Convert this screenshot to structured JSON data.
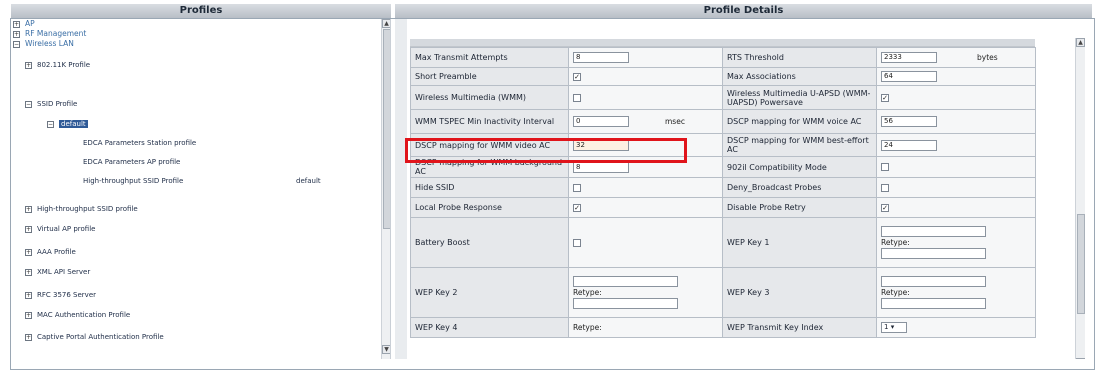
{
  "headers": {
    "profiles": "Profiles",
    "profile_details": "Profile Details"
  },
  "tree": {
    "top": [
      {
        "toggle": "+",
        "label": "AP"
      },
      {
        "toggle": "+",
        "label": "RF Management"
      },
      {
        "toggle": "−",
        "label": "Wireless LAN"
      }
    ],
    "wlan": {
      "k_profile": {
        "toggle": "+",
        "label": "802.11K Profile"
      },
      "ssid_profile": {
        "toggle": "−",
        "label": "SSID Profile"
      },
      "default": {
        "toggle": "−",
        "label": "default"
      },
      "children": [
        {
          "label": "EDCA Parameters Station profile",
          "value": ""
        },
        {
          "label": "EDCA Parameters AP profile",
          "value": ""
        },
        {
          "label": "High-throughput SSID Profile",
          "value": "default"
        }
      ],
      "more": [
        {
          "toggle": "+",
          "label": "High-throughput SSID profile"
        },
        {
          "toggle": "+",
          "label": "Virtual AP profile"
        },
        {
          "toggle": "+",
          "label": "AAA Profile"
        },
        {
          "toggle": "+",
          "label": "XML API Server"
        },
        {
          "toggle": "+",
          "label": "RFC 3576 Server"
        },
        {
          "toggle": "+",
          "label": "MAC Authentication Profile"
        },
        {
          "toggle": "+",
          "label": "Captive Portal Authentication Profile"
        }
      ]
    }
  },
  "details": {
    "max_transmit_attempts": {
      "label": "Max Transmit Attempts",
      "value": "8"
    },
    "rts_threshold": {
      "label": "RTS Threshold",
      "value": "2333",
      "unit": "bytes"
    },
    "short_preamble": {
      "label": "Short Preamble",
      "checked": "✓"
    },
    "max_associations": {
      "label": "Max Associations",
      "value": "64"
    },
    "wmm": {
      "label": "Wireless Multimedia (WMM)",
      "checked": ""
    },
    "wmm_uapsd": {
      "label": "Wireless Multimedia U-APSD (WMM-UAPSD) Powersave",
      "checked": "✓"
    },
    "wmm_tspec": {
      "label": "WMM TSPEC Min Inactivity Interval",
      "value": "0",
      "unit": "msec"
    },
    "dscp_voice": {
      "label": "DSCP mapping for WMM voice AC",
      "value": "56"
    },
    "dscp_video": {
      "label": "DSCP mapping for WMM video AC",
      "value": "32"
    },
    "dscp_best_effort": {
      "label": "DSCP mapping for WMM best-effort AC",
      "value": "24"
    },
    "dscp_background": {
      "label": "DSCP mapping for WMM background AC",
      "value": "8"
    },
    "compat_902il": {
      "label": "902il Compatibility Mode",
      "checked": ""
    },
    "hide_ssid": {
      "label": "Hide SSID",
      "checked": ""
    },
    "deny_broadcast": {
      "label": "Deny_Broadcast Probes",
      "checked": ""
    },
    "local_probe": {
      "label": "Local Probe Response",
      "checked": "✓"
    },
    "disable_retry": {
      "label": "Disable Probe Retry",
      "checked": "✓"
    },
    "battery_boost": {
      "label": "Battery Boost",
      "checked": ""
    },
    "wep_key_1": {
      "label": "WEP Key 1",
      "retype": "Retype:"
    },
    "wep_key_2": {
      "label": "WEP Key 2",
      "retype": "Retype:"
    },
    "wep_key_3": {
      "label": "WEP Key 3",
      "retype": "Retype:"
    },
    "wep_key_4": {
      "label": "WEP Key 4",
      "retype": "Retype:"
    },
    "wep_tx_index": {
      "label": "WEP Transmit Key Index",
      "value": "1"
    }
  },
  "colors": {
    "highlight": "#e0141b",
    "header_bg": "#c5cbd2",
    "selected": "#2f5a97"
  }
}
